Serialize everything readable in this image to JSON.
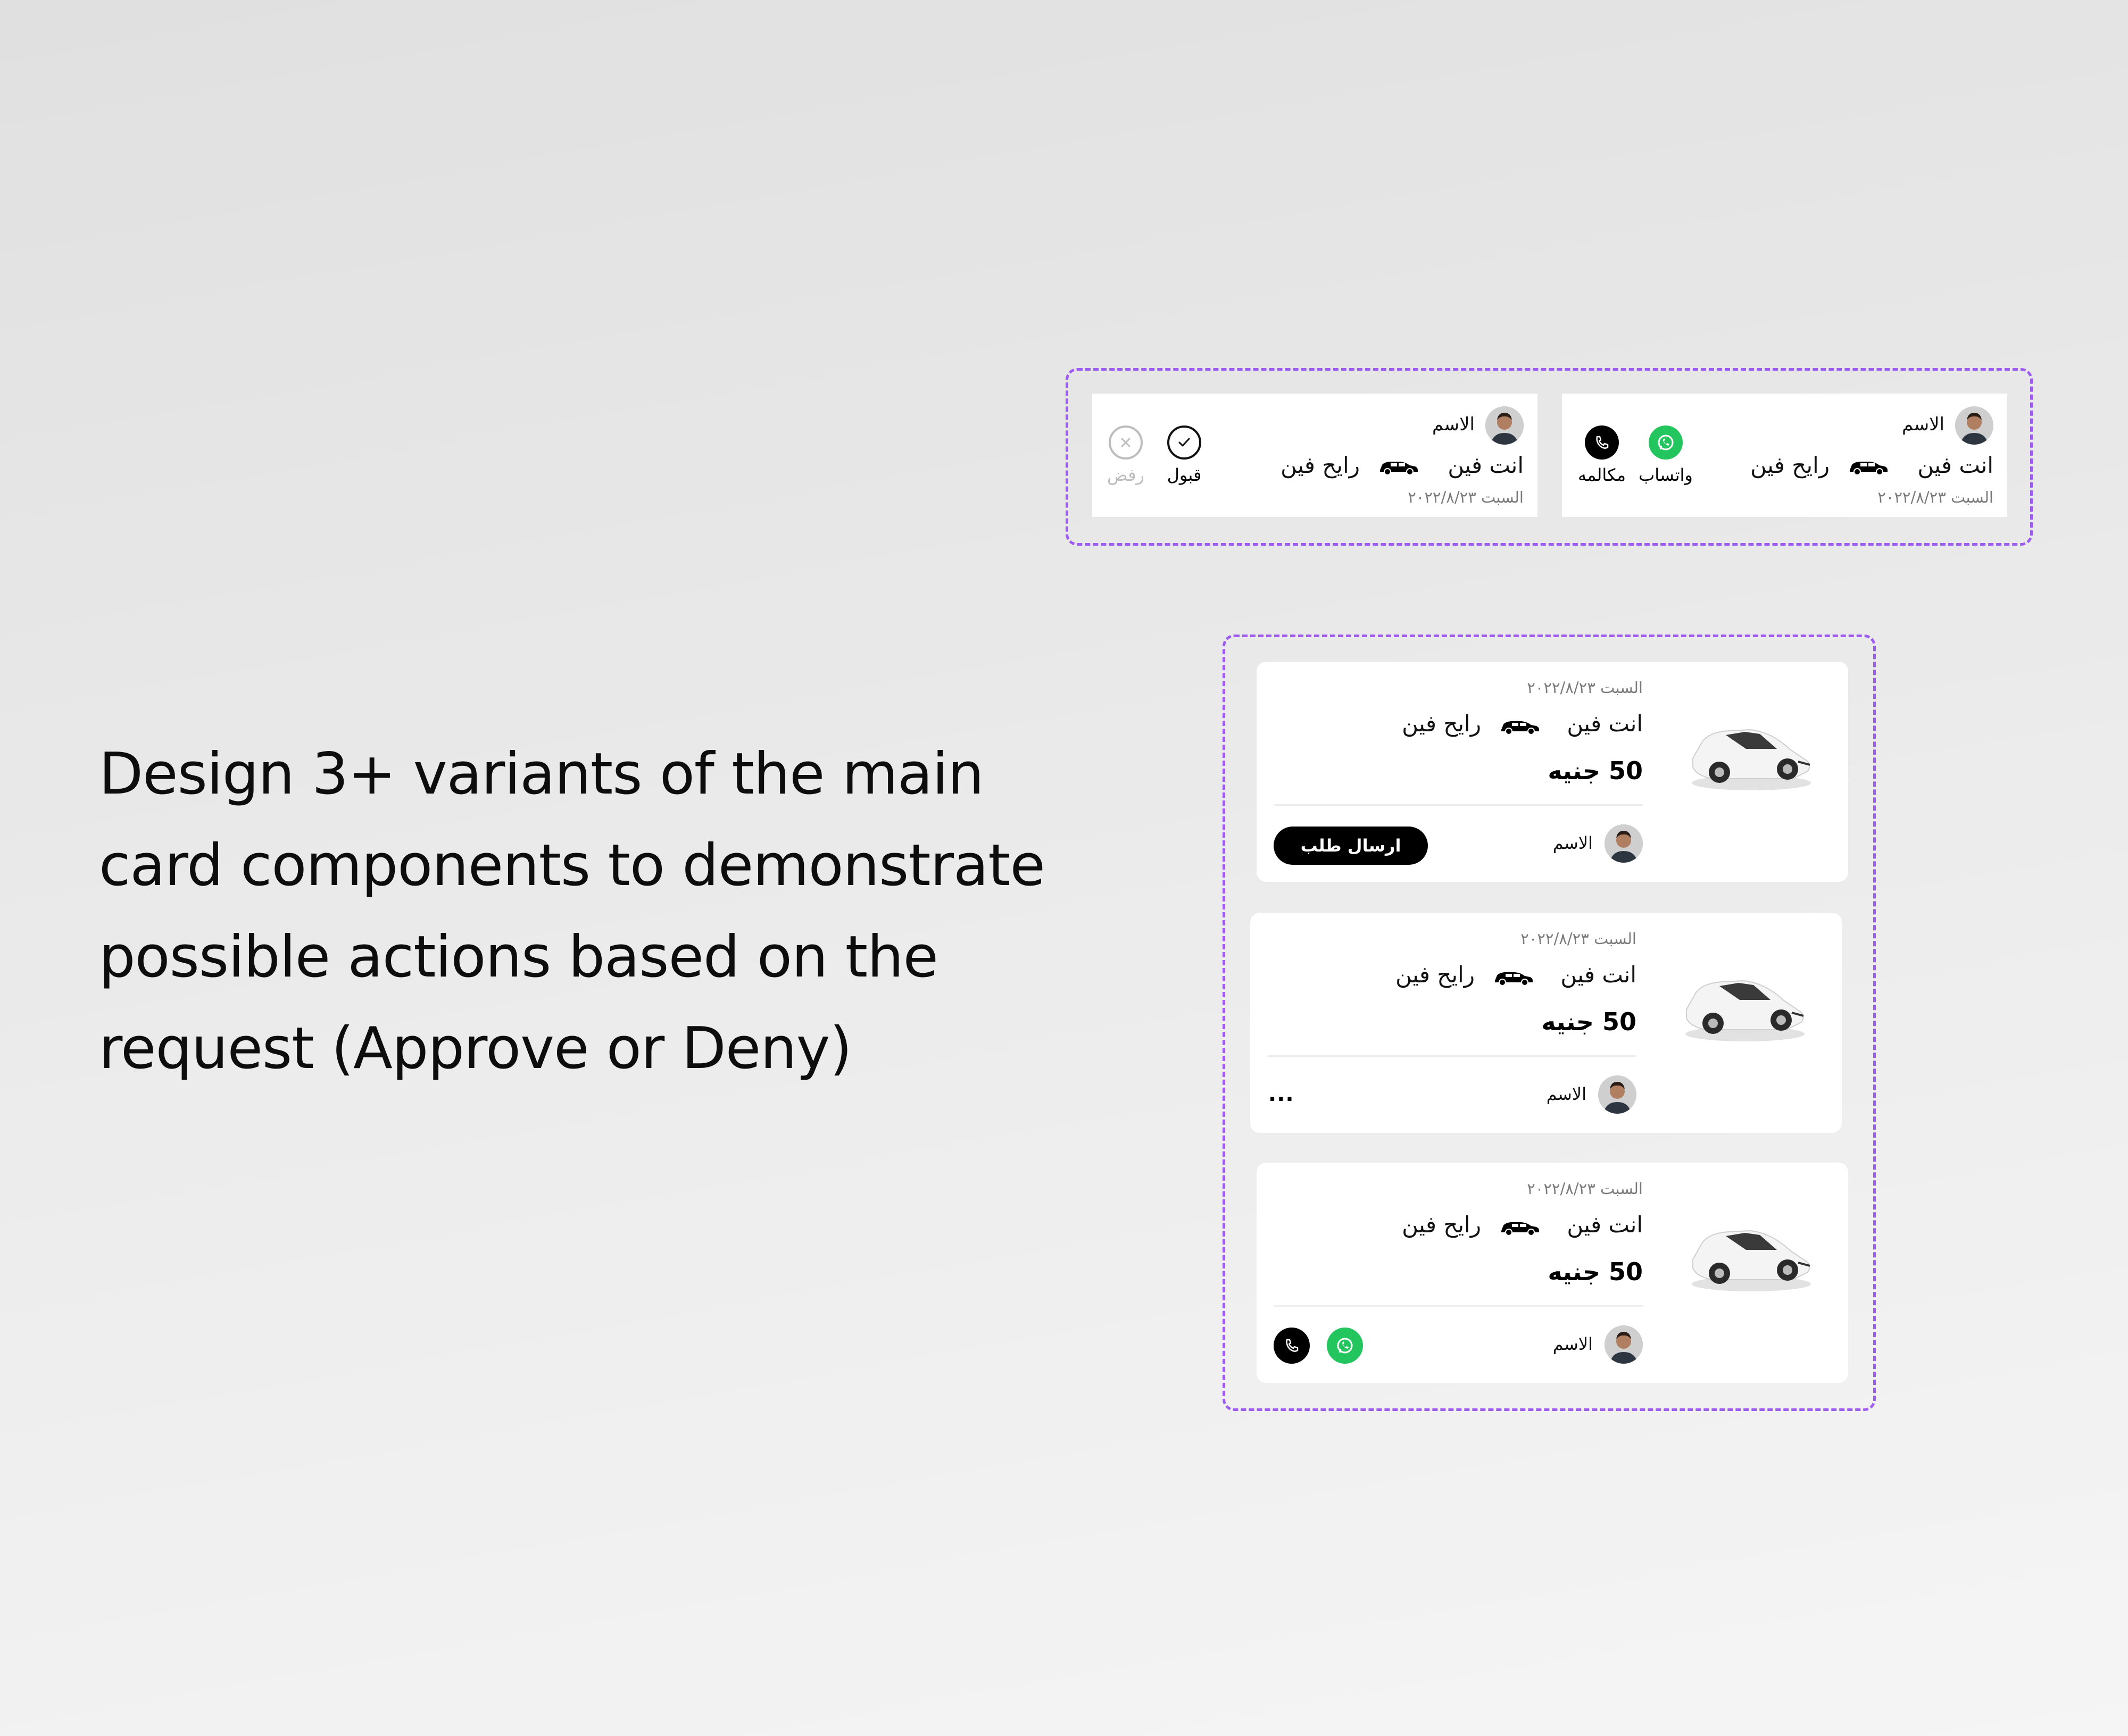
{
  "headline": {
    "line1": "Design 3+ variants of the main",
    "line2": "card components to demonstrate",
    "line3": "possible actions based on the",
    "line4": "request (Approve or Deny)"
  },
  "colors": {
    "dashed_frame": "#9e5cf0",
    "whatsapp_green": "#23c55e",
    "call_black": "#000000",
    "date_grey": "#7a7a7a"
  },
  "request_cards": [
    {
      "name": "الاسم",
      "from": "انت فين",
      "to": "رايح فين",
      "date": "السبت ٢٠٢٢/٨/٢٣",
      "actions": [
        {
          "label": "واتساب",
          "icon": "whatsapp-icon"
        },
        {
          "label": "مكالمه",
          "icon": "phone-icon"
        }
      ]
    },
    {
      "name": "الاسم",
      "from": "انت فين",
      "to": "رايح فين",
      "date": "السبت ٢٠٢٢/٨/٢٣",
      "actions": [
        {
          "label": "قبول",
          "icon": "check-icon"
        },
        {
          "label": "رفض",
          "icon": "close-icon"
        }
      ]
    }
  ],
  "ride_cards": [
    {
      "date": "السبت ٢٠٢٢/٨/٢٣",
      "from": "انت فين",
      "to": "رايح فين",
      "price": "50 جنيه",
      "name": "الاسم",
      "button": "ارسال طلب"
    },
    {
      "date": "السبت ٢٠٢٢/٨/٢٣",
      "from": "انت فين",
      "to": "رايح فين",
      "price": "50 جنيه",
      "name": "الاسم",
      "more": "..."
    },
    {
      "date": "السبت ٢٠٢٢/٨/٢٣",
      "from": "انت فين",
      "to": "رايح فين",
      "price": "50 جنيه",
      "name": "الاسم"
    }
  ]
}
